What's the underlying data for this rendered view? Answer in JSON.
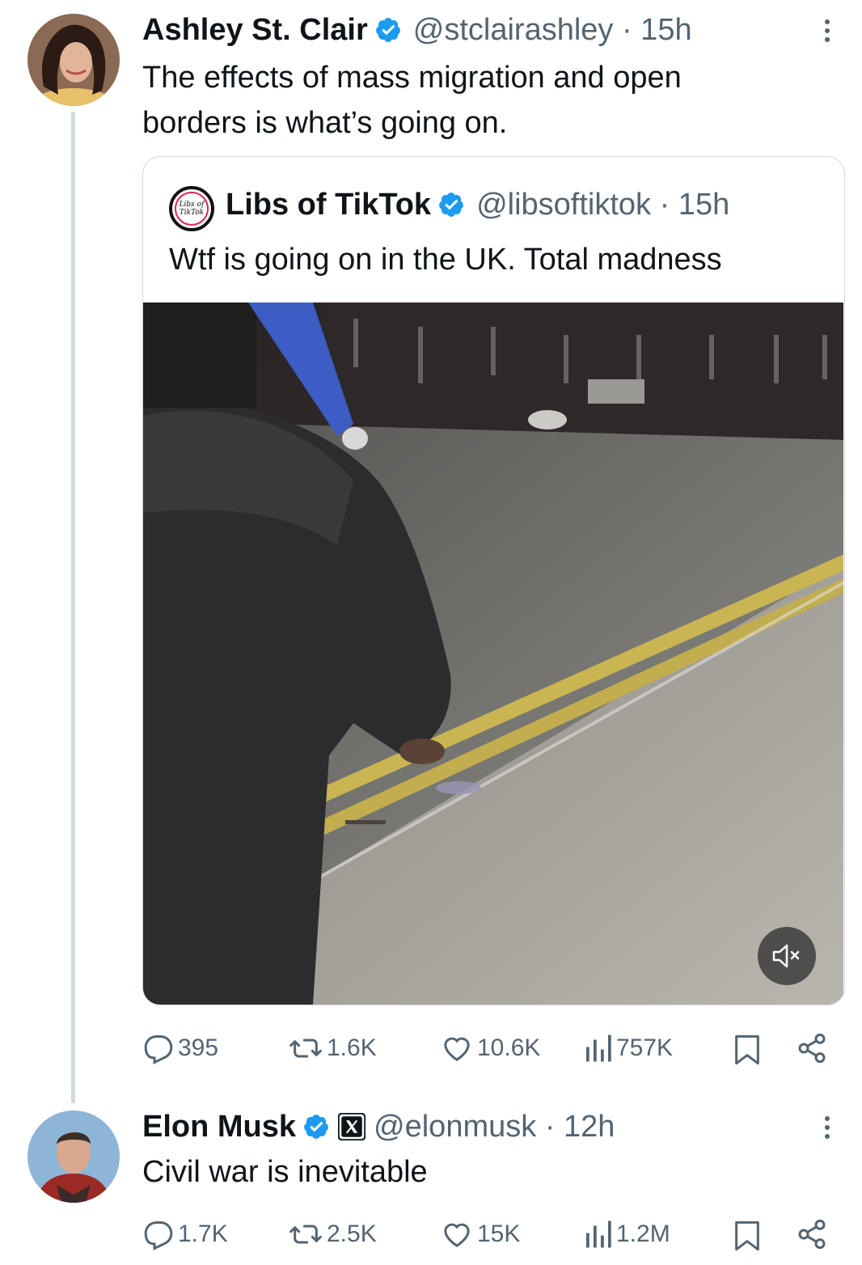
{
  "tweet1": {
    "author_name": "Ashley St. Clair",
    "handle_time": "@stclairashley · 15h",
    "text_line1": "The effects of mass migration and open",
    "text_line2": "borders is what’s going on.",
    "quote": {
      "author_name": "Libs of TikTok",
      "handle_time": "@libsoftiktok · 15h",
      "text": "Wtf is going on in the UK. Total madness",
      "logo_text_1": "Libs of",
      "logo_text_2": "TikTok"
    },
    "stats": {
      "replies": "395",
      "reposts": "1.6K",
      "likes": "10.6K",
      "views": "757K"
    }
  },
  "tweet2": {
    "author_name": "Elon Musk",
    "handle_time": "@elonmusk · 12h",
    "text": "Civil war is inevitable",
    "stats": {
      "replies": "1.7K",
      "reposts": "2.5K",
      "likes": "15K",
      "views": "1.2M"
    }
  },
  "colors": {
    "verified": "#1d9bf0",
    "muted": "#536471",
    "border": "#cfd9de"
  }
}
